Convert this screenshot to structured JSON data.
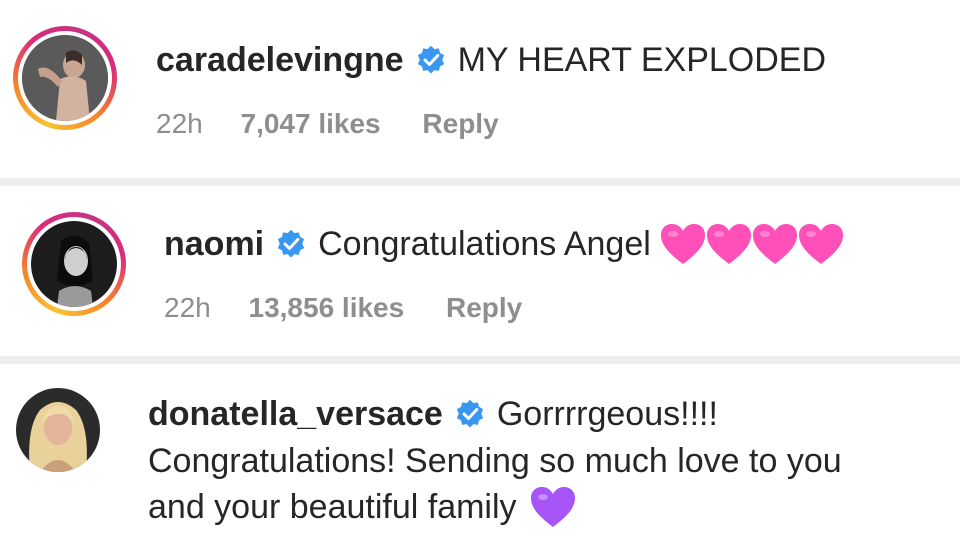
{
  "comments": [
    {
      "username": "caradelevingne",
      "text": "MY HEART EXPLODED",
      "time": "22h",
      "likes": "7,047 likes",
      "reply": "Reply"
    },
    {
      "username": "naomi",
      "text": "Congratulations Angel",
      "time": "22h",
      "likes": "13,856 likes",
      "reply": "Reply"
    },
    {
      "username": "donatella_versace",
      "text_first": "Gorrrrgeous!!!!",
      "text_line2": "Congratulations! Sending so much love to you",
      "text_line3": "and your beautiful family"
    }
  ],
  "colors": {
    "verified_badge": "#3897f0",
    "pink_heart": "#ff4fb8",
    "purple_heart": "#a855f7",
    "meta_text": "#8e8e8e",
    "divider": "#eeeeee"
  }
}
